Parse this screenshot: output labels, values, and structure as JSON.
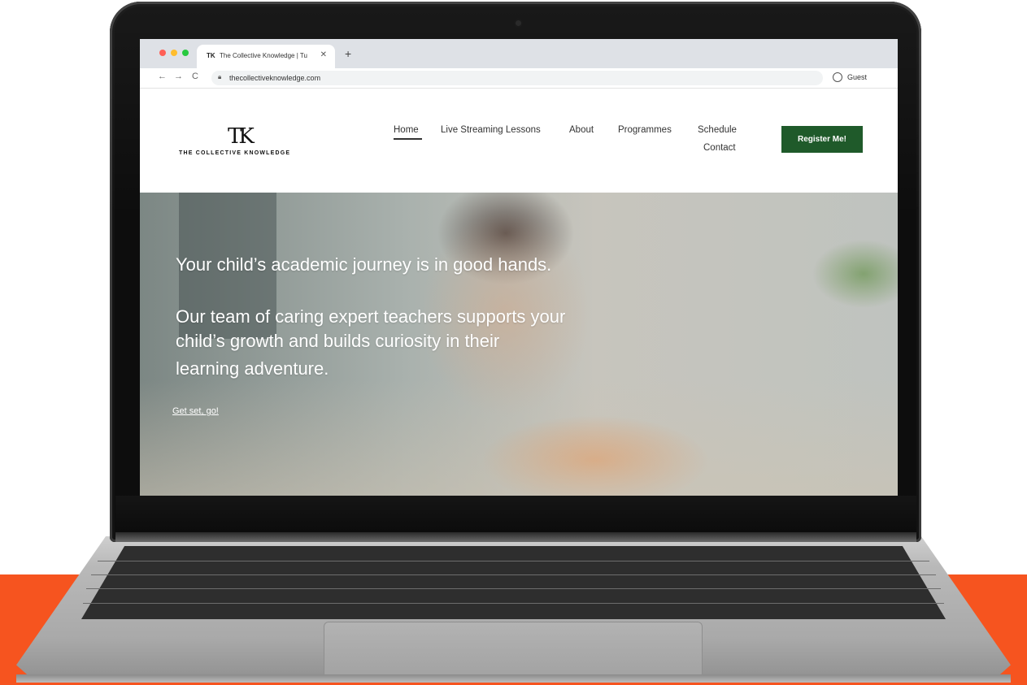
{
  "browser": {
    "tab_favicon": "TK",
    "tab_title": "The Collective Knowledge | Tu",
    "tab_close": "✕",
    "new_tab": "+",
    "back": "←",
    "forward": "→",
    "reload": "C",
    "lock_icon": "lock-icon",
    "url": "thecollectiveknowledge.com",
    "profile_label": "Guest"
  },
  "site": {
    "logo_mark": "TK",
    "logo_text": "THE COLLECTIVE KNOWLEDGE",
    "nav": {
      "home": "Home",
      "live": "Live Streaming Lessons",
      "about": "About",
      "programmes": "Programmes",
      "schedule": "Schedule",
      "contact": "Contact"
    },
    "register_label": "Register Me!",
    "accent_color": "#1f5a2a"
  },
  "hero": {
    "line1": "Your child’s academic journey is in good hands.",
    "line2": "Our team of caring expert teachers supports your",
    "line3": "child’s growth and builds curiosity in their",
    "line4": "learning adventure.",
    "cta": "Get set, go!"
  },
  "colors": {
    "band": "#f6541f"
  }
}
